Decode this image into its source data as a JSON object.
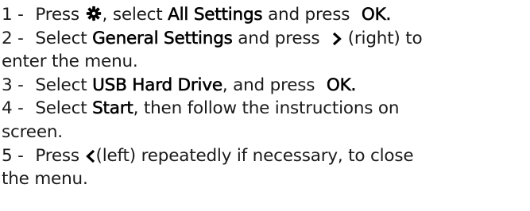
{
  "steps": [
    {
      "num": "1 -",
      "verb": "Press",
      "icon": "gear-icon",
      "mid": ", select",
      "target": "All Settings",
      "and": "and press",
      "action": "OK."
    },
    {
      "num": "2 -",
      "verb": "Select",
      "target": "General Settings",
      "and": "and press",
      "icon": "chevron-right-icon",
      "tail_1": "(right) to",
      "tail_2": "enter the menu."
    },
    {
      "num": "3 -",
      "verb": "Select",
      "target": "USB Hard Drive",
      "and": ", and press",
      "action": "OK."
    },
    {
      "num": "4 -",
      "verb": "Select",
      "target": "Start",
      "tail_1": ", then follow the instructions on",
      "tail_2": "screen."
    },
    {
      "num": "5 -",
      "verb": "Press",
      "icon": "chevron-left-icon",
      "tail_1": "(left) repeatedly if necessary, to close",
      "tail_2": "the menu."
    }
  ]
}
